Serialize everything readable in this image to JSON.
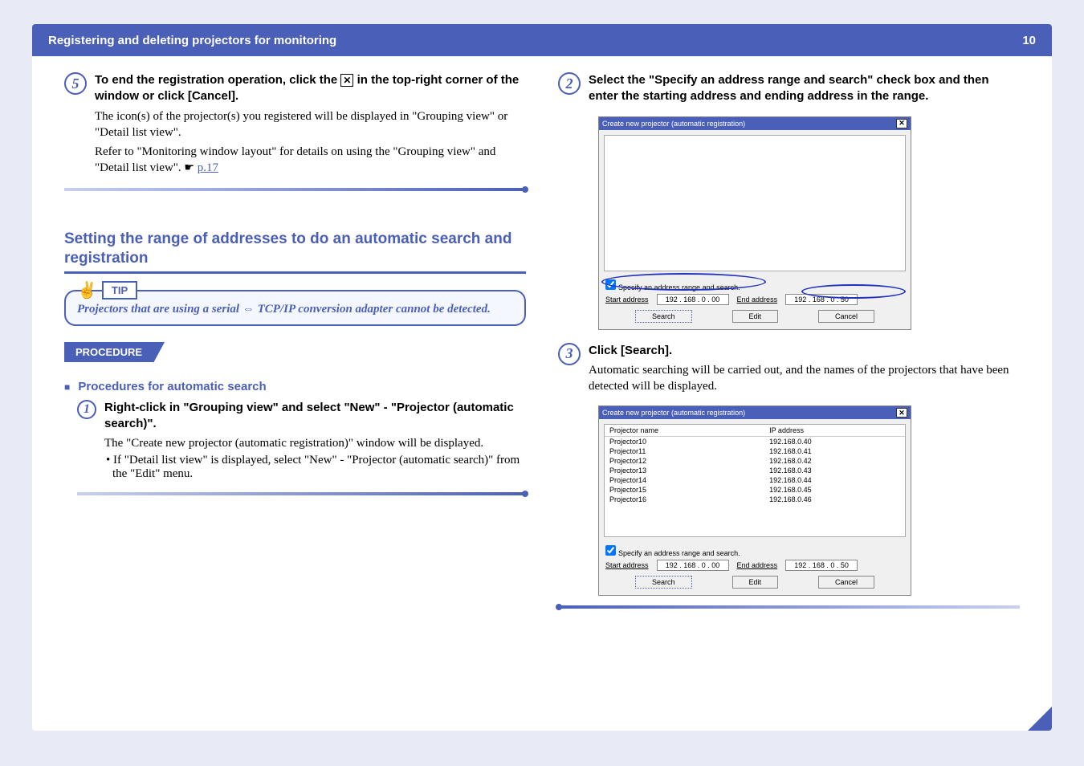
{
  "header": {
    "title": "Registering and deleting projectors for monitoring",
    "pageNum": "10"
  },
  "left": {
    "step5": {
      "num": "5",
      "bold_pre": "To end the registration operation, click the ",
      "bold_post": " in the top-right corner of the window or click [Cancel].",
      "body1": "The icon(s) of the projector(s) you registered will be displayed in \"Grouping view\" or \"Detail list view\".",
      "body2_pre": "Refer to \"Monitoring window layout\" for details on using the \"Grouping view\" and \"Detail list view\".  ",
      "link": "p.17"
    },
    "section": "Setting the range of addresses to do an automatic search and registration",
    "tip_label": "TIP",
    "tip_body": "Projectors that are using a serial ⇔ TCP/IP conversion adapter cannot be detected.",
    "proc": "PROCEDURE",
    "subh": "Procedures for automatic search",
    "step1": {
      "num": "1",
      "bold": "Right-click in \"Grouping view\" and select \"New\" - \"Projector (automatic search)\".",
      "body": "The \"Create new projector (automatic registration)\" window will be displayed.",
      "bullet": "• If \"Detail list view\" is displayed, select \"New\" - \"Projector (automatic search)\" from the \"Edit\" menu."
    }
  },
  "right": {
    "step2": {
      "num": "2",
      "bold": "Select the \"Specify an address range and search\" check box and then enter the starting address and ending address in the range."
    },
    "dialog1": {
      "title": "Create new projector (automatic registration)",
      "chk": "Specify an address range and search.",
      "start_label": "Start address",
      "start_ip": "192 . 168 .  0  . 00",
      "end_label": "End address",
      "end_ip": "192 . 168 .  0  . 50",
      "search": "Search",
      "edit": "Edit",
      "cancel": "Cancel"
    },
    "step3": {
      "num": "3",
      "bold": "Click [Search].",
      "body": "Automatic searching will be carried out, and the names of the projectors that have been detected will be displayed."
    },
    "dialog2": {
      "title": "Create new projector (automatic registration)",
      "col1": "Projector name",
      "col2": "IP address",
      "rows": [
        {
          "n": "Projector10",
          "ip": "192.168.0.40"
        },
        {
          "n": "Projector11",
          "ip": "192.168.0.41"
        },
        {
          "n": "Projector12",
          "ip": "192.168.0.42"
        },
        {
          "n": "Projector13",
          "ip": "192.168.0.43"
        },
        {
          "n": "Projector14",
          "ip": "192.168.0.44"
        },
        {
          "n": "Projector15",
          "ip": "192.168.0.45"
        },
        {
          "n": "Projector16",
          "ip": "192.168.0.46"
        }
      ],
      "chk": "Specify an address range and search.",
      "start_label": "Start address",
      "start_ip": "192 . 168 .  0  . 00",
      "end_label": "End address",
      "end_ip": "192 . 168 .  0  . 50",
      "search": "Search",
      "edit": "Edit",
      "cancel": "Cancel"
    }
  }
}
